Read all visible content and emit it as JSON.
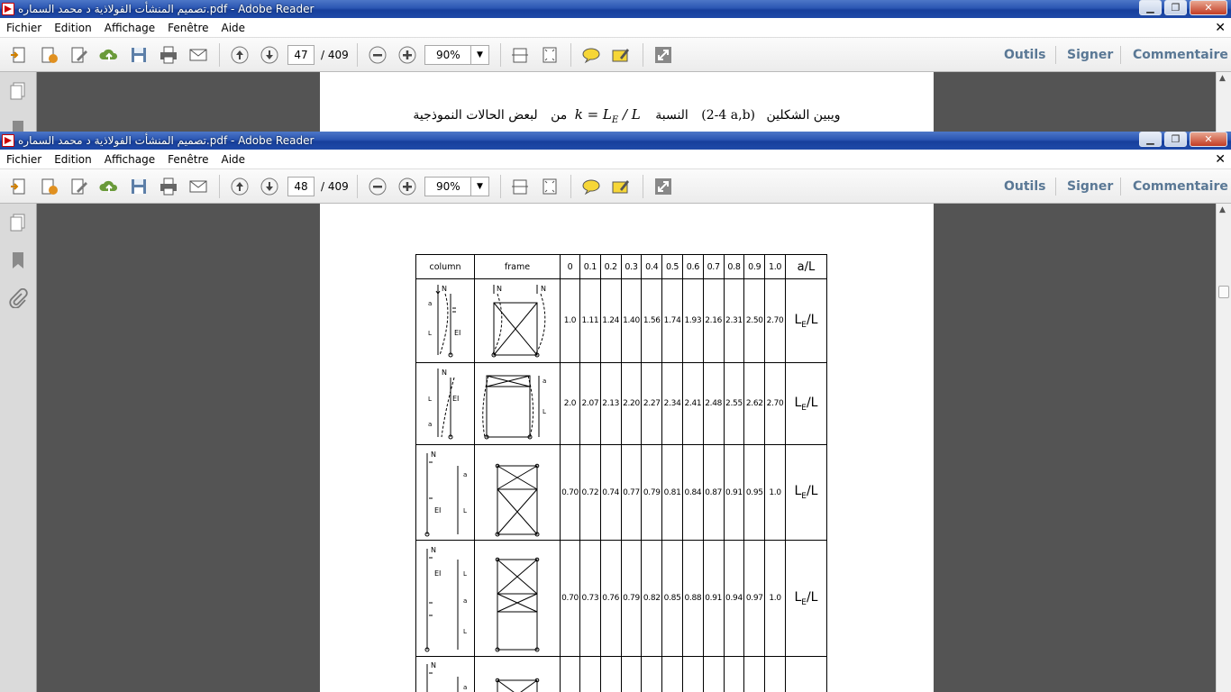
{
  "windows": [
    {
      "title": "تصميم المنشأت الفولاذية د محمد السماره.pdf - Adobe Reader",
      "menu": [
        "Fichier",
        "Edition",
        "Affichage",
        "Fenêtre",
        "Aide"
      ],
      "page_current": "47",
      "page_total": "/ 409",
      "zoom": "90%",
      "tools": [
        "Outils",
        "Signer",
        "Commentaire"
      ],
      "body_text": "ويبين الشكلين (4-2 a,b) النسبة k = L_E / L لبعض الحالات النموذجية من",
      "formula": "k = LE / L"
    },
    {
      "title": "تصميم المنشأت الفولاذية د محمد السماره.pdf - Adobe Reader",
      "menu": [
        "Fichier",
        "Edition",
        "Affichage",
        "Fenêtre",
        "Aide"
      ],
      "page_current": "48",
      "page_total": "/ 409",
      "zoom": "90%",
      "tools": [
        "Outils",
        "Signer",
        "Commentaire"
      ]
    }
  ],
  "table": {
    "headers": [
      "column",
      "frame",
      "0",
      "0.1",
      "0.2",
      "0.3",
      "0.4",
      "0.5",
      "0.6",
      "0.7",
      "0.8",
      "0.9",
      "1.0",
      "a/L"
    ],
    "rows": [
      {
        "values": [
          "1.0",
          "1.11",
          "1.24",
          "1.40",
          "1.56",
          "1.74",
          "1.93",
          "2.16",
          "2.31",
          "2.50",
          "2.70"
        ],
        "ratio": "LE/L"
      },
      {
        "values": [
          "2.0",
          "2.07",
          "2.13",
          "2.20",
          "2.27",
          "2.34",
          "2.41",
          "2.48",
          "2.55",
          "2.62",
          "2.70"
        ],
        "ratio": "LE/L"
      },
      {
        "values": [
          "0.70",
          "0.72",
          "0.74",
          "0.77",
          "0.79",
          "0.81",
          "0.84",
          "0.87",
          "0.91",
          "0.95",
          "1.0"
        ],
        "ratio": "LE/L"
      },
      {
        "values": [
          "0.70",
          "0.73",
          "0.76",
          "0.79",
          "0.82",
          "0.85",
          "0.88",
          "0.91",
          "0.94",
          "0.97",
          "1.0"
        ],
        "ratio": "LE/L"
      }
    ]
  },
  "icons": [
    "create-pdf-icon",
    "convert-icon",
    "edit-icon",
    "upload-icon",
    "save-icon",
    "print-icon",
    "email-icon",
    "page-up-icon",
    "page-down-icon",
    "zoom-out-icon",
    "zoom-in-icon",
    "fit-width-icon",
    "fit-page-icon",
    "comment-icon",
    "highlight-icon",
    "fullscreen-icon"
  ]
}
